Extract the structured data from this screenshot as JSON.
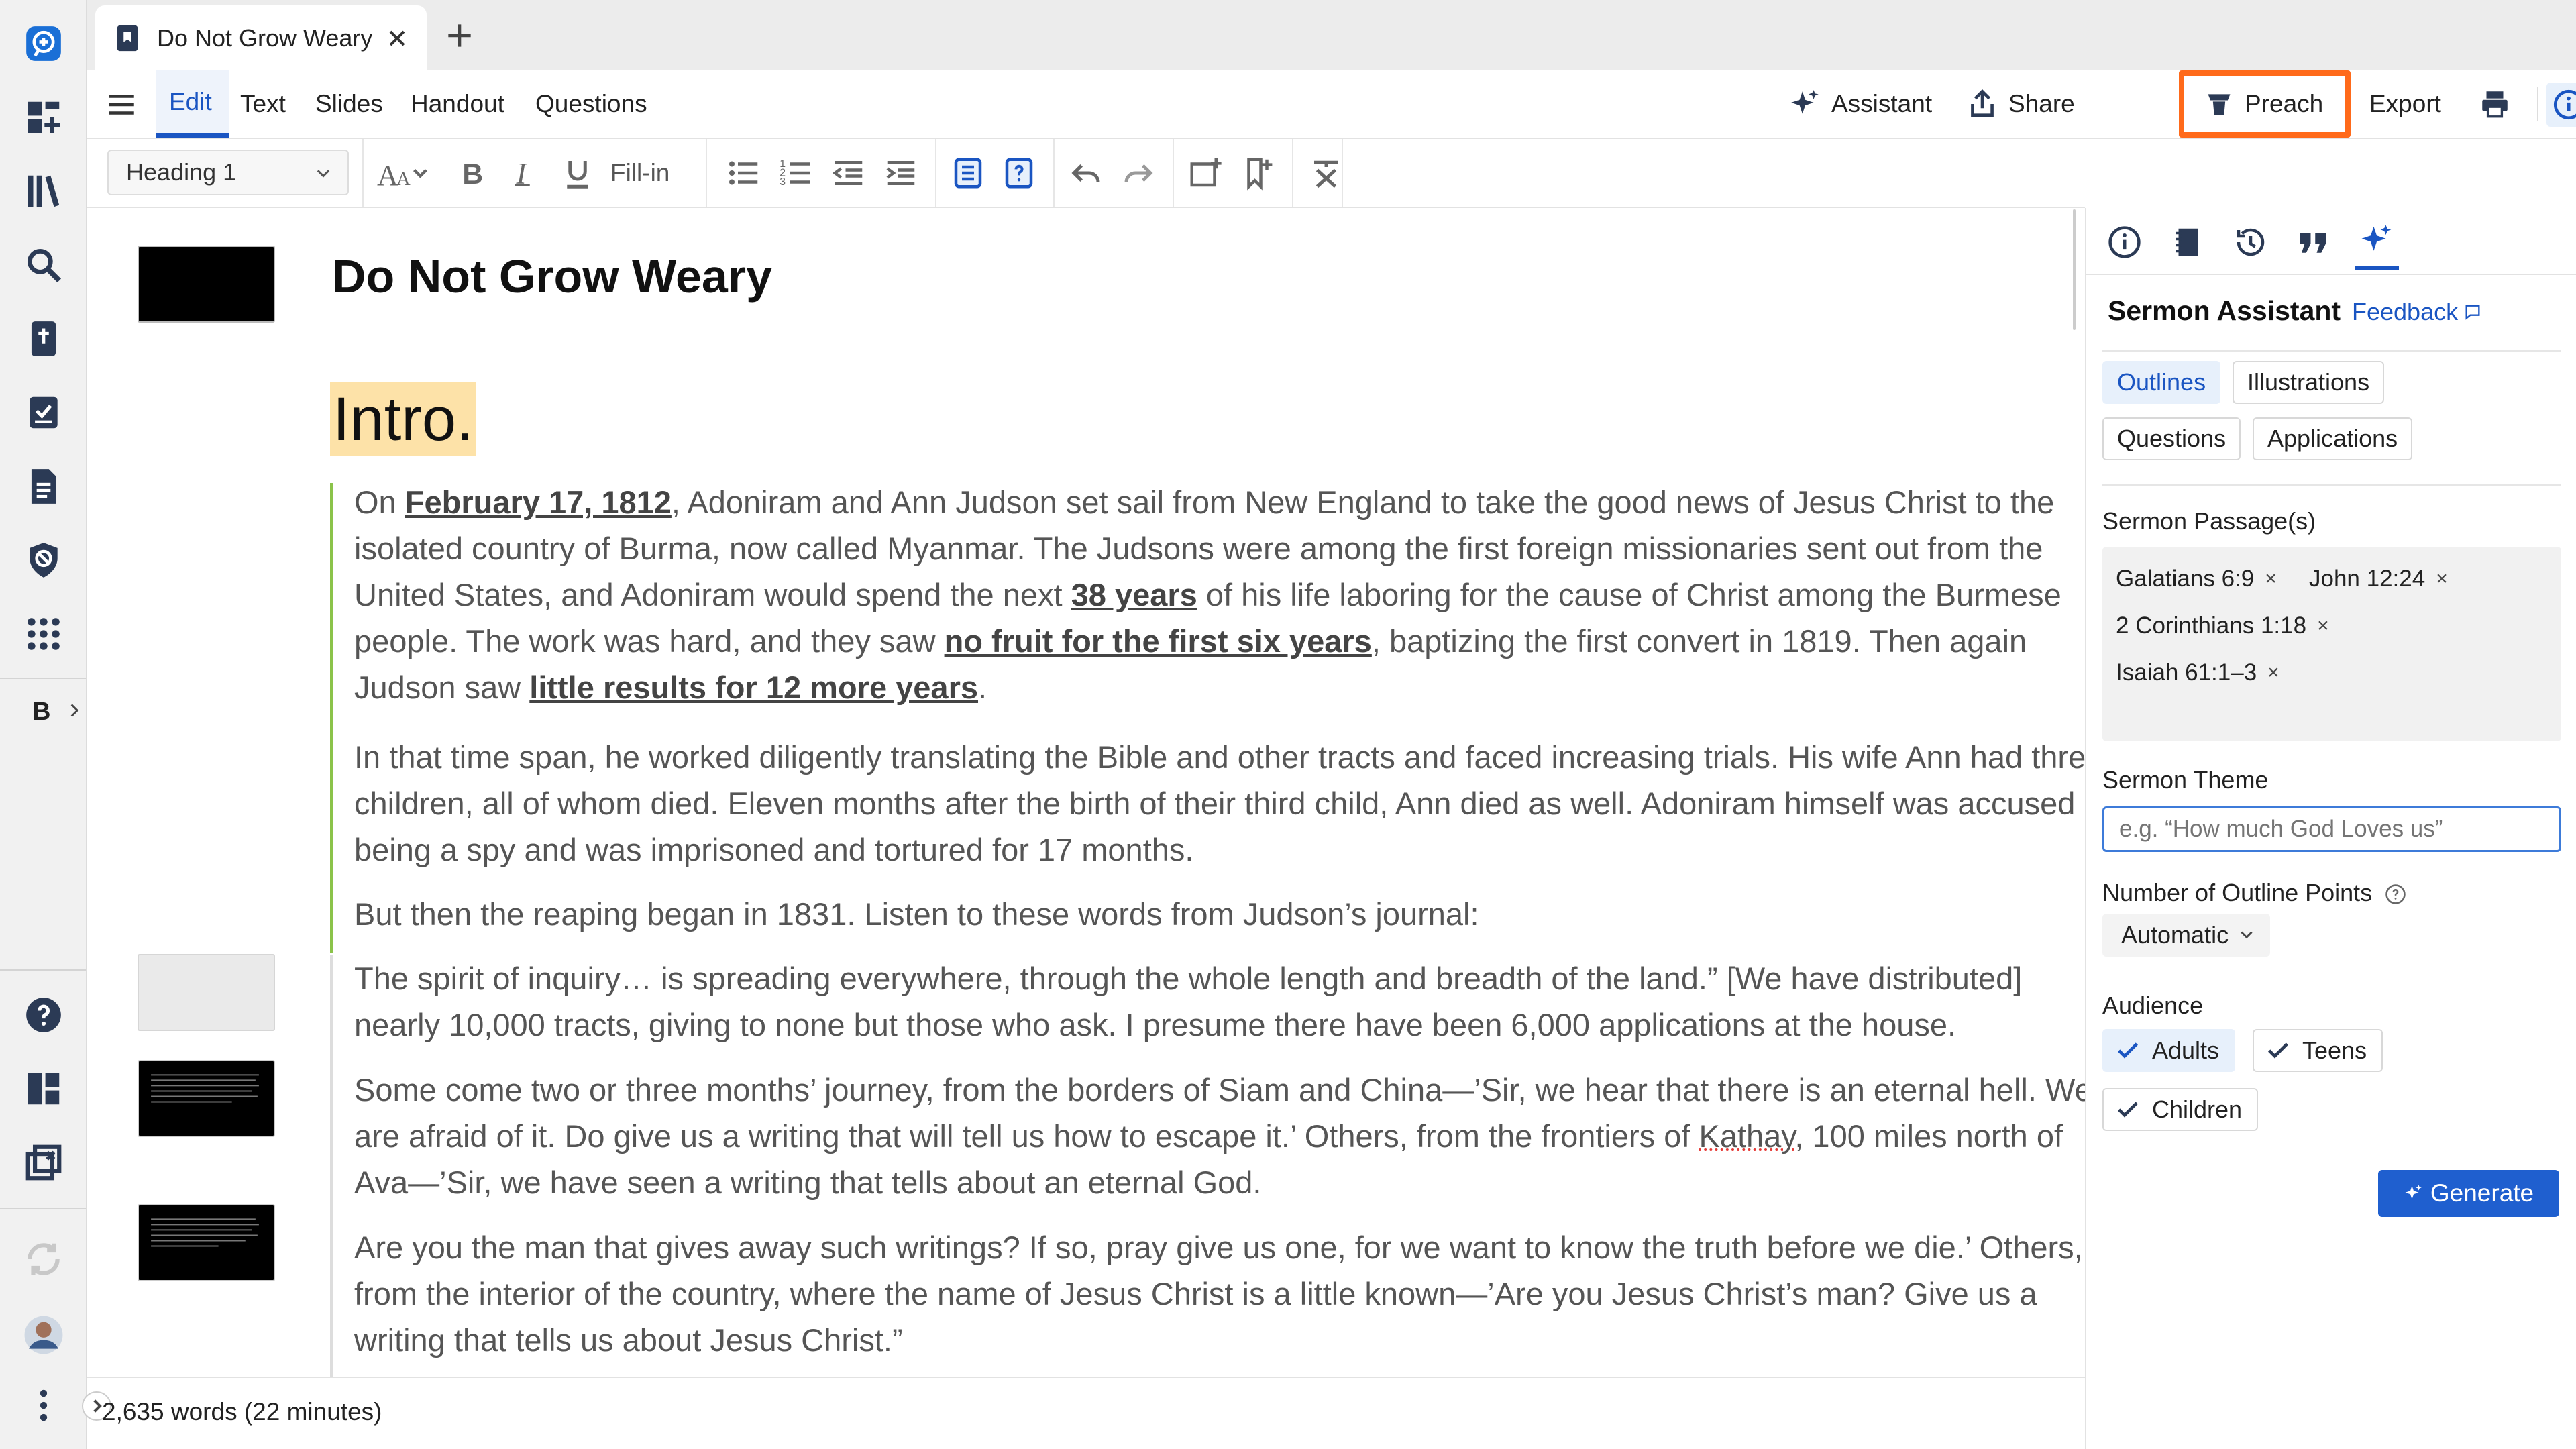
{
  "tab": {
    "title": "Do Not Grow Weary"
  },
  "menu": {
    "tabs": [
      "Edit",
      "Text",
      "Slides",
      "Handout",
      "Questions"
    ],
    "assistant": "Assistant",
    "share": "Share",
    "preach": "Preach",
    "export": "Export"
  },
  "toolbar": {
    "style_value": "Heading 1",
    "fill_in": "Fill-in"
  },
  "rail": {
    "bible_label": "B"
  },
  "document": {
    "title": "Do Not Grow Weary",
    "heading": "Intro.",
    "p1": {
      "t1": "On ",
      "l1": "February 17, 1812",
      "t2": ", Adoniram and Ann Judson set sail from New England to take the good news of Jesus Christ to the isolated country of Burma, now called Myanmar. The Judsons were among the first foreign missionaries sent out from the United States, and Adoniram would spend the next ",
      "l2": "38 years",
      "t3": " of his life laboring for the cause of Christ among the Burmese people. The work was hard, and they saw ",
      "l3": "no fruit for the first six years",
      "t4": ", baptizing the first convert in 1819. Then again Judson saw ",
      "l4": "little results for 12 more years",
      "t5": "."
    },
    "p2": "In that time span, he worked diligently translating the Bible and other tracts and faced increasing trials. His wife Ann had three children, all of whom died. Eleven months after the birth of their third child, Ann died as well. Adoniram himself was accused of being a spy and was imprisoned and tortured for 17 months.",
    "p3": "But then the reaping began in 1831. Listen to these words from Judson’s journal:",
    "p4": "The spirit of inquiry… is spreading everywhere, through the whole length and breadth of the land.” [We have distributed] nearly 10,000 tracts, giving to none but those who ask. I presume there have been 6,000 applications at the house.",
    "p5": {
      "t1": "Some come two or three months’ journey, from the borders of Siam and China—’Sir, we hear that there is an eternal hell. We are afraid of it. Do give us a writing that will tell us how to escape it.’ Others, from the frontiers of ",
      "spell": "Kathay",
      "t2": ", 100 miles north of Ava—’Sir, we have seen a writing that tells about an eternal God."
    },
    "p6": "Are you the man that gives away such writings? If so, pray give us one, for we want to know the truth before we die.’ Others, from the interior of the country, where the name of Jesus Christ is a little known—’Are you Jesus Christ’s man? Give us a writing that tells us about Jesus Christ.”"
  },
  "status": {
    "word_count": "2,635 words (22 minutes)"
  },
  "panel": {
    "title": "Sermon Assistant",
    "feedback": "Feedback",
    "modes": [
      "Outlines",
      "Illustrations",
      "Questions",
      "Applications"
    ],
    "passages_label": "Sermon Passage(s)",
    "passages": [
      "Galatians 6:9",
      "John 12:24",
      "2 Corinthians 1:18",
      "Isaiah 61:1–3"
    ],
    "chip_remove": "×",
    "theme_label": "Sermon Theme",
    "theme_placeholder": "e.g. “How much God Loves us”",
    "points_label": "Number of Outline Points",
    "points_value": "Automatic",
    "audience_label": "Audience",
    "audience": [
      "Adults",
      "Teens",
      "Children"
    ],
    "generate": "Generate"
  },
  "colors": {
    "accent": "#1a55c2",
    "preach_outline": "#ff6a1a",
    "highlight": "#fde2a8",
    "section_bar": "#8bc34a"
  }
}
